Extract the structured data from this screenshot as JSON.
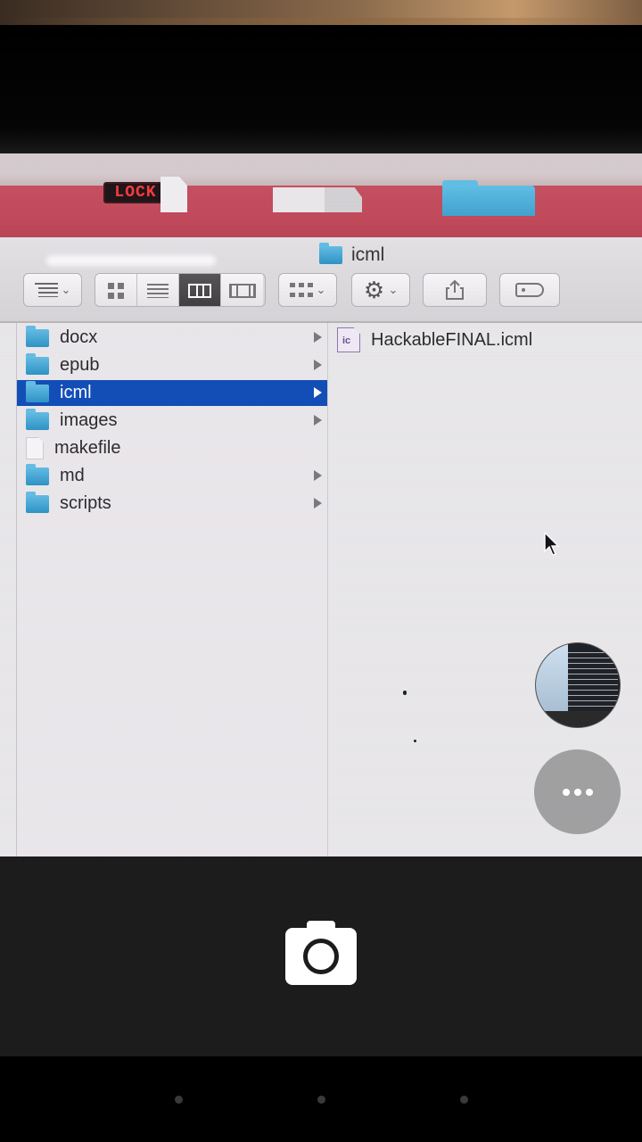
{
  "desktop": {
    "lock_label": "LOCK"
  },
  "finder": {
    "title": "icml",
    "toolbar": {
      "view_options_icon": "list-options-icon",
      "view_modes": [
        "icon-view",
        "list-view",
        "column-view",
        "cover-flow-view"
      ],
      "active_view": "column-view",
      "arrange_icon": "arrange-icon",
      "action_icon": "gear-icon",
      "share_icon": "share-icon",
      "tag_icon": "tag-icon"
    },
    "sidebar_column": {
      "items": [
        {
          "label": "docx",
          "kind": "folder"
        },
        {
          "label": "epub",
          "kind": "folder"
        },
        {
          "label": "icml",
          "kind": "folder",
          "selected": true
        },
        {
          "label": "images",
          "kind": "folder"
        },
        {
          "label": "makefile",
          "kind": "file"
        },
        {
          "label": "md",
          "kind": "folder"
        },
        {
          "label": "scripts",
          "kind": "folder"
        }
      ]
    },
    "contents_column": {
      "items": [
        {
          "label": "HackableFINAL.icml",
          "icon_text": "ic"
        }
      ]
    }
  },
  "camera": {
    "more_icon": "more-horizontal-icon",
    "shutter_icon": "camera-icon",
    "thumbnail": "last-photo-thumbnail"
  },
  "colors": {
    "selection": "#0f4fb8",
    "folder": "#3fa6d0",
    "camera_bar": "#1c1c1c"
  }
}
